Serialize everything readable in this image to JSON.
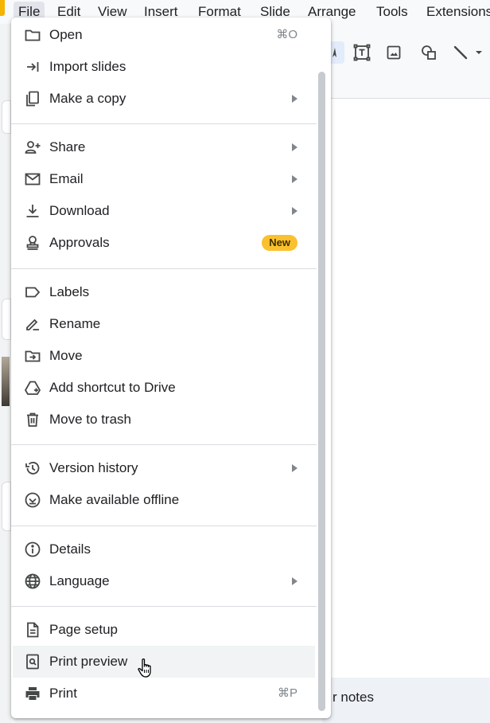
{
  "menubar": {
    "items": [
      "File",
      "Edit",
      "View",
      "Insert",
      "Format",
      "Slide",
      "Arrange",
      "Tools",
      "Extensions"
    ],
    "active": "File"
  },
  "toolbar": {
    "icons": [
      "cursor-icon",
      "text-box-icon",
      "image-icon",
      "shapes-icon",
      "line-icon",
      "dropdown-arrow-icon"
    ]
  },
  "notes": {
    "text": "r notes"
  },
  "file_menu": {
    "open": {
      "label": "Open",
      "shortcut": "⌘O",
      "icon": "folder-icon"
    },
    "import_slides": {
      "label": "Import slides",
      "icon": "import-icon"
    },
    "make_copy": {
      "label": "Make a copy",
      "icon": "copy-icon",
      "submenu": true
    },
    "share": {
      "label": "Share",
      "icon": "person-add-icon",
      "submenu": true
    },
    "email": {
      "label": "Email",
      "icon": "mail-icon",
      "submenu": true
    },
    "download": {
      "label": "Download",
      "icon": "download-icon",
      "submenu": true
    },
    "approvals": {
      "label": "Approvals",
      "icon": "approvals-icon",
      "badge": "New"
    },
    "labels": {
      "label": "Labels",
      "icon": "label-icon"
    },
    "rename": {
      "label": "Rename",
      "icon": "rename-icon"
    },
    "move": {
      "label": "Move",
      "icon": "move-folder-icon"
    },
    "add_shortcut": {
      "label": "Add shortcut to Drive",
      "icon": "drive-shortcut-icon"
    },
    "move_to_trash": {
      "label": "Move to trash",
      "icon": "trash-icon"
    },
    "version_history": {
      "label": "Version history",
      "icon": "history-icon",
      "submenu": true
    },
    "offline": {
      "label": "Make available offline",
      "icon": "offline-icon"
    },
    "details": {
      "label": "Details",
      "icon": "info-icon"
    },
    "language": {
      "label": "Language",
      "icon": "globe-icon",
      "submenu": true
    },
    "page_setup": {
      "label": "Page setup",
      "icon": "page-icon"
    },
    "print_preview": {
      "label": "Print preview",
      "icon": "print-preview-icon",
      "hovered": true
    },
    "print": {
      "label": "Print",
      "shortcut": "⌘P",
      "icon": "printer-icon"
    }
  },
  "colors": {
    "badge_bg": "#fbc02d",
    "hover_bg": "#f1f3f4",
    "menubar_active_bg": "#e1e4ea",
    "icon": "#444746"
  }
}
